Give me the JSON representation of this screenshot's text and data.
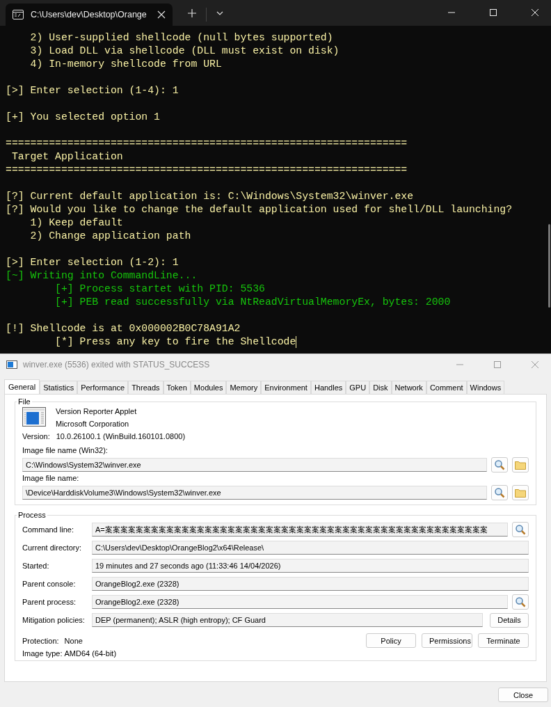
{
  "terminal": {
    "tab_title": "C:\\Users\\dev\\Desktop\\Orange",
    "lines": [
      {
        "kind": "text",
        "text": "    2) User-supplied shellcode (null bytes supported)",
        "color": "#f9f1a5"
      },
      {
        "kind": "text",
        "text": "    3) Load DLL via shellcode (DLL must exist on disk)",
        "color": "#f9f1a5"
      },
      {
        "kind": "text",
        "text": "    4) In-memory shellcode from URL",
        "color": "#f9f1a5"
      },
      {
        "kind": "blank"
      },
      {
        "kind": "text",
        "text": "[>] Enter selection (1-4): 1",
        "color": "#f9f1a5"
      },
      {
        "kind": "blank"
      },
      {
        "kind": "text",
        "text": "[+] You selected option 1",
        "color": "#f9f1a5"
      },
      {
        "kind": "blank"
      },
      {
        "kind": "text",
        "text": "=================================================================",
        "color": "#f9f1a5"
      },
      {
        "kind": "text",
        "text": " Target Application",
        "color": "#f9f1a5"
      },
      {
        "kind": "text",
        "text": "=================================================================",
        "color": "#f9f1a5"
      },
      {
        "kind": "blank"
      },
      {
        "kind": "text",
        "text": "[?] Current default application is: C:\\Windows\\System32\\winver.exe",
        "color": "#f9f1a5"
      },
      {
        "kind": "text",
        "text": "[?] Would you like to change the default application used for shell/DLL launching?",
        "color": "#f9f1a5"
      },
      {
        "kind": "text",
        "text": "    1) Keep default",
        "color": "#f9f1a5"
      },
      {
        "kind": "text",
        "text": "    2) Change application path",
        "color": "#f9f1a5"
      },
      {
        "kind": "blank"
      },
      {
        "kind": "text",
        "text": "[>] Enter selection (1-2): 1",
        "color": "#f9f1a5"
      },
      {
        "kind": "text",
        "text": "[~] Writing into CommandLine...",
        "color": "#16c60c"
      },
      {
        "kind": "text",
        "text": "        [+] Process startet with PID: 5536",
        "color": "#16c60c"
      },
      {
        "kind": "text",
        "text": "        [+] PEB read successfully via NtReadVirtualMemoryEx, bytes: 2000",
        "color": "#16c60c"
      },
      {
        "kind": "blank"
      },
      {
        "kind": "text",
        "text": "[!] Shellcode is at 0x000002B0C78A91A2",
        "color": "#f9f1a5"
      },
      {
        "kind": "prompt",
        "text": "        [*] Press any key to fire the Shellcode",
        "color": "#f9f1a5"
      }
    ]
  },
  "properties": {
    "title": "winver.exe (5536) exited with STATUS_SUCCESS",
    "tabs": [
      {
        "label": "General",
        "selected": true
      },
      {
        "label": "Statistics",
        "selected": false
      },
      {
        "label": "Performance",
        "selected": false
      },
      {
        "label": "Threads",
        "selected": false
      },
      {
        "label": "Token",
        "selected": false
      },
      {
        "label": "Modules",
        "selected": false
      },
      {
        "label": "Memory",
        "selected": false
      },
      {
        "label": "Environment",
        "selected": false
      },
      {
        "label": "Handles",
        "selected": false
      },
      {
        "label": "GPU",
        "selected": false
      },
      {
        "label": "Disk",
        "selected": false
      },
      {
        "label": "Network",
        "selected": false
      },
      {
        "label": "Comment",
        "selected": false
      },
      {
        "label": "Windows",
        "selected": false
      }
    ],
    "file": {
      "heading": "File",
      "description": "Version Reporter Applet",
      "company": "Microsoft Corporation",
      "version_label": "Version:",
      "version": "10.0.26100.1 (WinBuild.160101.0800)",
      "fields": [
        {
          "label": "Image file name (Win32):",
          "value": "C:\\Windows\\System32\\winver.exe"
        },
        {
          "label": "Image file name:",
          "value": "\\Device\\HarddiskVolume3\\Windows\\System32\\winver.exe"
        }
      ]
    },
    "process": {
      "heading": "Process",
      "rows": [
        {
          "label": "Command line:",
          "value": "A=案案案案案案案案案案案案案案案案案案案案案案案案案案案案案案案案案案案案案案案案案案案案案案案案案案",
          "kind": "search"
        },
        {
          "label": "Current directory:",
          "value": "C:\\Users\\dev\\Desktop\\OrangeBlog2\\x64\\Release\\",
          "kind": "none"
        },
        {
          "label": "Started:",
          "value": "19 minutes and 27 seconds ago (11:33:46 14/04/2026)",
          "kind": "none"
        },
        {
          "label": "Parent console:",
          "value": "OrangeBlog2.exe (2328)",
          "kind": "none"
        },
        {
          "label": "Parent process:",
          "value": "OrangeBlog2.exe (2328)",
          "kind": "search"
        },
        {
          "label": "Mitigation policies:",
          "value": "DEP (permanent); ASLR (high entropy); CF Guard",
          "kind": "details",
          "action_label": "Details"
        }
      ],
      "protection_label": "Protection:",
      "protection": "None",
      "image_type_label": "Image type:",
      "image_type": "AMD64 (64-bit)",
      "buttons": [
        "Policy",
        "Permissions",
        "Terminate"
      ]
    },
    "close_button": "Close"
  }
}
